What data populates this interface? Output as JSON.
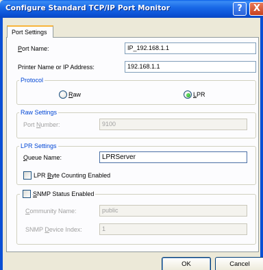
{
  "window": {
    "title": "Configure Standard TCP/IP Port Monitor",
    "help_glyph": "?",
    "close_glyph": "X"
  },
  "tabs": [
    {
      "label": "Port Settings"
    }
  ],
  "port_settings": {
    "port_name": {
      "label_access": "P",
      "label_rest": "ort Name:",
      "value": "IP_192.168.1.1"
    },
    "printer_address": {
      "label": "Printer Name or IP Address:",
      "value": "192.168.1.1"
    }
  },
  "protocol": {
    "legend": "Protocol",
    "raw": {
      "label_access": "R",
      "label_rest": "aw",
      "selected": false
    },
    "lpr": {
      "label_access": "L",
      "label_rest": "PR",
      "selected": true
    }
  },
  "raw_settings": {
    "legend": "Raw Settings",
    "port_number": {
      "label_pre": "Port ",
      "label_access": "N",
      "label_rest": "umber:",
      "value": "9100",
      "enabled": false
    }
  },
  "lpr_settings": {
    "legend": "LPR Settings",
    "queue_name": {
      "label_access": "Q",
      "label_rest": "ueue Name:",
      "value": "LPRServer"
    },
    "byte_counting": {
      "label_pre": "LPR ",
      "label_access": "B",
      "label_rest": "yte Counting Enabled",
      "checked": false
    }
  },
  "snmp": {
    "status_enabled": {
      "label_access": "S",
      "label_rest": "NMP Status Enabled",
      "checked": false
    },
    "community_name": {
      "label_access": "C",
      "label_rest": "ommunity Name:",
      "value": "public",
      "enabled": false
    },
    "device_index": {
      "label_pre": "SNMP ",
      "label_access": "D",
      "label_rest": "evice Index:",
      "value": "1",
      "enabled": false
    }
  },
  "buttons": {
    "ok": "OK",
    "cancel": "Cancel"
  }
}
